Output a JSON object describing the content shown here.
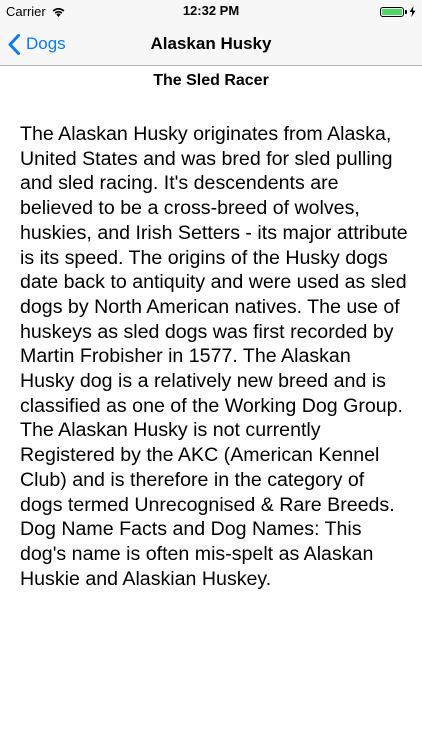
{
  "status_bar": {
    "carrier": "Carrier",
    "time": "12:32 PM",
    "battery_level": 1.0,
    "battery_color": "#4cd964"
  },
  "nav_bar": {
    "back_label": "Dogs",
    "title": "Alaskan Husky",
    "accent_color": "#0a7aff"
  },
  "content": {
    "subtitle": "The Sled Racer",
    "body": "The Alaskan Husky originates from Alaska, United States and was bred for sled pulling and sled racing. It's descendents are believed to be a cross-breed of wolves, huskies, and Irish Setters - its major attribute is its speed. The origins of the Husky dogs date back to antiquity and were used as sled dogs by North American natives. The use of huskeys as sled dogs was first recorded by Martin Frobisher in 1577. The Alaskan Husky dog is a relatively new breed and is classified as one of the Working Dog Group. The Alaskan Husky is not currently Registered by the AKC (American Kennel Club) and is therefore in the category of dogs termed Unrecognised & Rare Breeds. Dog Name Facts and Dog Names: This dog's name is often mis-spelt as Alaskan Huskie and Alaskian Huskey."
  }
}
